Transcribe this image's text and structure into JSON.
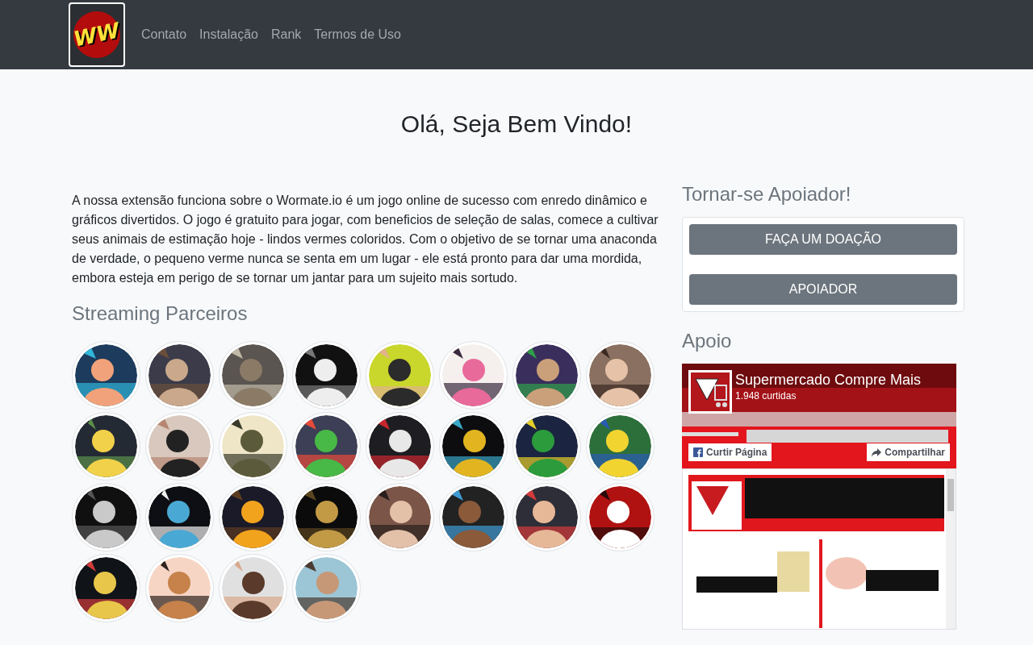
{
  "navbar": {
    "logo_text": "WW",
    "links": [
      "Contato",
      "Instalação",
      "Rank",
      "Termos de Uso"
    ]
  },
  "heading": "Olá, Seja Bem Vindo!",
  "intro": "A nossa extensão funciona sobre o Wormate.io é um jogo online de sucesso com enredo dinâmico e gráficos divertidos. O jogo é gratuito para jogar, com beneficios de seleção de salas, comece a cultivar seus animais de estimação hoje - lindos vermes coloridos. Com o objetivo de se tornar uma anaconda de verdade, o pequeno verme nunca se senta em um lugar - ele está pronto para dar uma mordida, embora esteja em perigo de se tornar um jantar para um sujeito mais sortudo.",
  "partners": {
    "title": "Streaming Parceiros"
  },
  "support": {
    "title": "Tornar-se Apoiador!",
    "buttons": [
      "FAÇA UM DOAÇÃO",
      "APOIADOR"
    ]
  },
  "apoio": {
    "title": "Apoio",
    "page_plugin": {
      "page_name": "Supermercado Compre Mais",
      "likes": "1.948 curtidas",
      "like_button": "Curtir Página",
      "share_button": "Compartilhar"
    }
  }
}
